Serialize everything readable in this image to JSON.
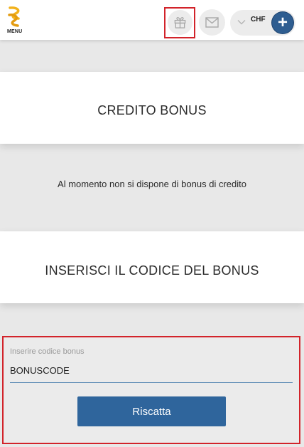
{
  "header": {
    "menu_label": "MENU",
    "gift_icon": "gift-icon",
    "mail_icon": "mail-icon",
    "currency": "CHF",
    "add_icon": "plus-icon",
    "accent_color": "#2e5d90",
    "highlight_color": "#d2232a"
  },
  "bonus_credit": {
    "title": "CREDITO BONUS",
    "empty_message": "Al momento non si dispone di bonus di credito"
  },
  "bonus_code": {
    "title": "INSERISCI IL CODICE DEL BONUS",
    "input_label": "Inserire codice bonus",
    "input_value": "BONUSCODE",
    "redeem_label": "Riscatta"
  }
}
